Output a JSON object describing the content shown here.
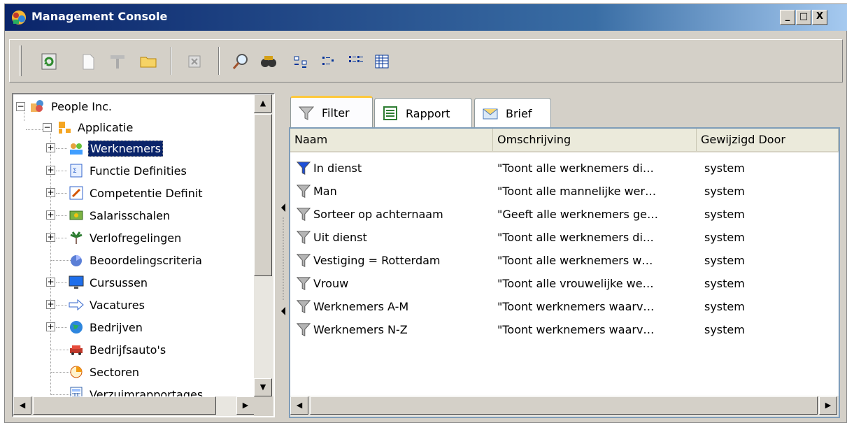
{
  "window": {
    "title": "Management Console"
  },
  "window_buttons": [
    "_",
    "□",
    "X"
  ],
  "toolbar": {
    "icons": [
      "refresh-icon",
      "new-icon",
      "properties-icon",
      "open-folder-icon",
      "delete-icon",
      "search-icon",
      "binoculars-icon",
      "large-icons-view-icon",
      "small-icons-view-icon",
      "list-view-icon",
      "details-view-icon"
    ]
  },
  "tree": {
    "root": {
      "label": "People Inc.",
      "icon": "people-folder-icon"
    },
    "child": {
      "label": "Applicatie",
      "icon": "app-icon"
    },
    "items": [
      {
        "label": "Werknemers",
        "icon": "employees-icon",
        "expandable": true,
        "selected": true
      },
      {
        "label": "Functie Definities",
        "icon": "function-definitions-icon",
        "expandable": true
      },
      {
        "label": "Competentie Definit",
        "icon": "competence-icon",
        "expandable": true
      },
      {
        "label": "Salarisschalen",
        "icon": "salary-icon",
        "expandable": true
      },
      {
        "label": "Verlofregelingen",
        "icon": "palm-tree-icon",
        "expandable": true
      },
      {
        "label": "Beoordelingscriteria",
        "icon": "criteria-icon",
        "expandable": false
      },
      {
        "label": "Cursussen",
        "icon": "monitor-icon",
        "expandable": true
      },
      {
        "label": "Vacatures",
        "icon": "arrow-right-icon",
        "expandable": true
      },
      {
        "label": "Bedrijven",
        "icon": "globe-icon",
        "expandable": true
      },
      {
        "label": "Bedrijfsauto's",
        "icon": "car-icon",
        "expandable": false
      },
      {
        "label": "Sectoren",
        "icon": "pie-icon",
        "expandable": false
      },
      {
        "label": "Verzuimrapportages",
        "icon": "calculator-icon",
        "expandable": false
      }
    ]
  },
  "tabs": [
    {
      "label": "Filter",
      "icon": "filter-icon",
      "active": true
    },
    {
      "label": "Rapport",
      "icon": "report-icon",
      "active": false
    },
    {
      "label": "Brief",
      "icon": "envelope-icon",
      "active": false
    }
  ],
  "list": {
    "columns": [
      "Naam",
      "Omschrijving",
      "Gewijzigd Door"
    ],
    "rows": [
      {
        "name": "In dienst",
        "desc": "\"Toont alle werknemers di…",
        "by": "system",
        "active": true
      },
      {
        "name": "Man",
        "desc": "\"Toont alle mannelijke wer…",
        "by": "system"
      },
      {
        "name": "Sorteer op achternaam",
        "desc": "\"Geeft alle werknemers ge…",
        "by": "system"
      },
      {
        "name": "Uit dienst",
        "desc": "\"Toont alle werknemers di…",
        "by": "system"
      },
      {
        "name": "Vestiging = Rotterdam",
        "desc": "\"Toont alle werknemers w…",
        "by": "system"
      },
      {
        "name": "Vrouw",
        "desc": "\"Toont alle vrouwelijke we…",
        "by": "system"
      },
      {
        "name": "Werknemers A-M",
        "desc": "\"Toont werknemers waarv…",
        "by": "system"
      },
      {
        "name": "Werknemers N-Z",
        "desc": "\"Toont werknemers waarv…",
        "by": "system"
      }
    ]
  },
  "colors": {
    "title_start": "#0a246a",
    "title_end": "#a6caf0",
    "selection": "#0a246a",
    "tab_highlight": "#ffc83c"
  }
}
